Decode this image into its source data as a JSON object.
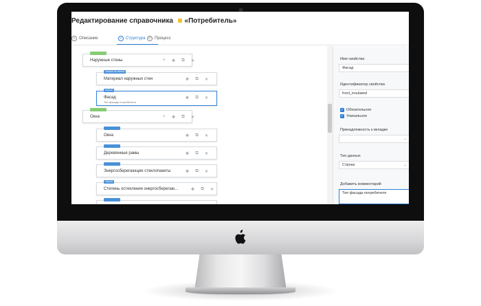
{
  "page": {
    "title": "Редактирование справочника",
    "title_suffix": "«Потребитель»"
  },
  "tabs": [
    {
      "label": "Описание",
      "icon": "document-icon",
      "active": false
    },
    {
      "label": "Структура",
      "icon": "structure-icon",
      "active": true
    },
    {
      "label": "Процесс",
      "icon": "process-icon",
      "active": false
    }
  ],
  "tree": {
    "nodes": [
      {
        "badge": "",
        "badge_color": "#86cc74",
        "label": "Наружные стены",
        "sublabel": "",
        "selected": false
      },
      {
        "badge": "ссылка на запись",
        "badge_color": "#4a90d9",
        "label": "Материал наружных стен",
        "sublabel": "",
        "selected": false
      },
      {
        "badge": "строка",
        "badge_color": "#4a90d9",
        "label": "Фасад",
        "sublabel": "Тип фасада потребителя",
        "selected": true
      },
      {
        "badge": "",
        "badge_color": "#86cc74",
        "label": "Окна",
        "sublabel": "",
        "selected": false
      },
      {
        "badge": "",
        "badge_color": "#4a90d9",
        "label": "Окна",
        "sublabel": "",
        "selected": false
      },
      {
        "badge": "",
        "badge_color": "#4a90d9",
        "label": "Деревянные рамы",
        "sublabel": "",
        "selected": false
      },
      {
        "badge": "",
        "badge_color": "#4a90d9",
        "label": "Энергосберегающие стеклопакеты",
        "sublabel": "",
        "selected": false
      },
      {
        "badge": "строка",
        "badge_color": "#4a90d9",
        "label": "Степень остекления энергосберегаю...",
        "sublabel": "",
        "selected": false
      },
      {
        "badge": "",
        "badge_color": "#4a90d9",
        "label": "",
        "sublabel": "",
        "selected": false
      }
    ],
    "icons": {
      "add": "plus-icon",
      "move": "move-icon",
      "copy": "copy-icon",
      "delete": "close-icon"
    }
  },
  "properties": {
    "name_label": "Имя свойства",
    "name_value": "Фасад",
    "id_label": "Идентификатор свойства",
    "id_value": "front_insulated",
    "required_label": "Обязательное",
    "unique_label": "Уникальное",
    "tab_label": "Принадлежность к вкладке",
    "tab_value": "",
    "type_label": "Тип данных",
    "type_value": "Строка",
    "comment_label": "Добавить комментарий",
    "comment_value": "Тип фасада потребителя"
  },
  "colors": {
    "accent": "#2f7fd6",
    "group_badge": "#86cc74",
    "field_badge": "#4a90d9"
  }
}
